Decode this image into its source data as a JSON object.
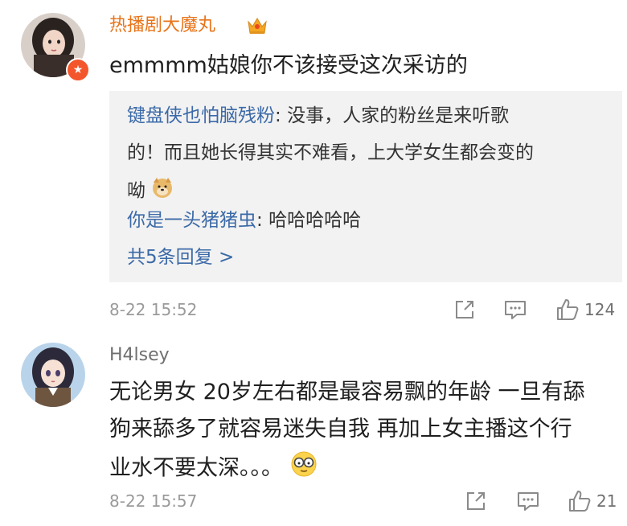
{
  "comments": [
    {
      "username": "热播剧大魔丸",
      "text": "emmmm姑娘你不该接受这次采访的",
      "replies": [
        {
          "user": "键盘侠也怕脑残粉",
          "lines": [
            "没事，人家的粉丝是来听歌",
            "的！而且她长得其实不难看，上大学女生都会变的",
            "呦"
          ]
        },
        {
          "user": "你是一头猪猪虫",
          "lines": [
            "哈哈哈哈哈"
          ]
        }
      ],
      "more_replies": "共5条回复 >",
      "timestamp": "8-22 15:52",
      "likes": "124"
    },
    {
      "username": "H4lsey",
      "lines": [
        "无论男女 20岁左右都是最容易飘的年龄 一旦有舔",
        "狗来舔多了就容易迷失自我 再加上女主播这个行",
        "业水不要太深。。。"
      ],
      "timestamp": "8-22 15:57",
      "likes": "21"
    }
  ],
  "colors": {
    "vip_name": "#e8741a",
    "reply_user": "#3c6aa8",
    "reply_bg": "#f2f2f2",
    "meta": "#9a9a9a"
  },
  "icons": [
    "vip-badge-icon",
    "crown-icon",
    "doge-emoji-icon",
    "share-icon",
    "comment-icon",
    "like-icon",
    "glasses-emoji-icon"
  ]
}
